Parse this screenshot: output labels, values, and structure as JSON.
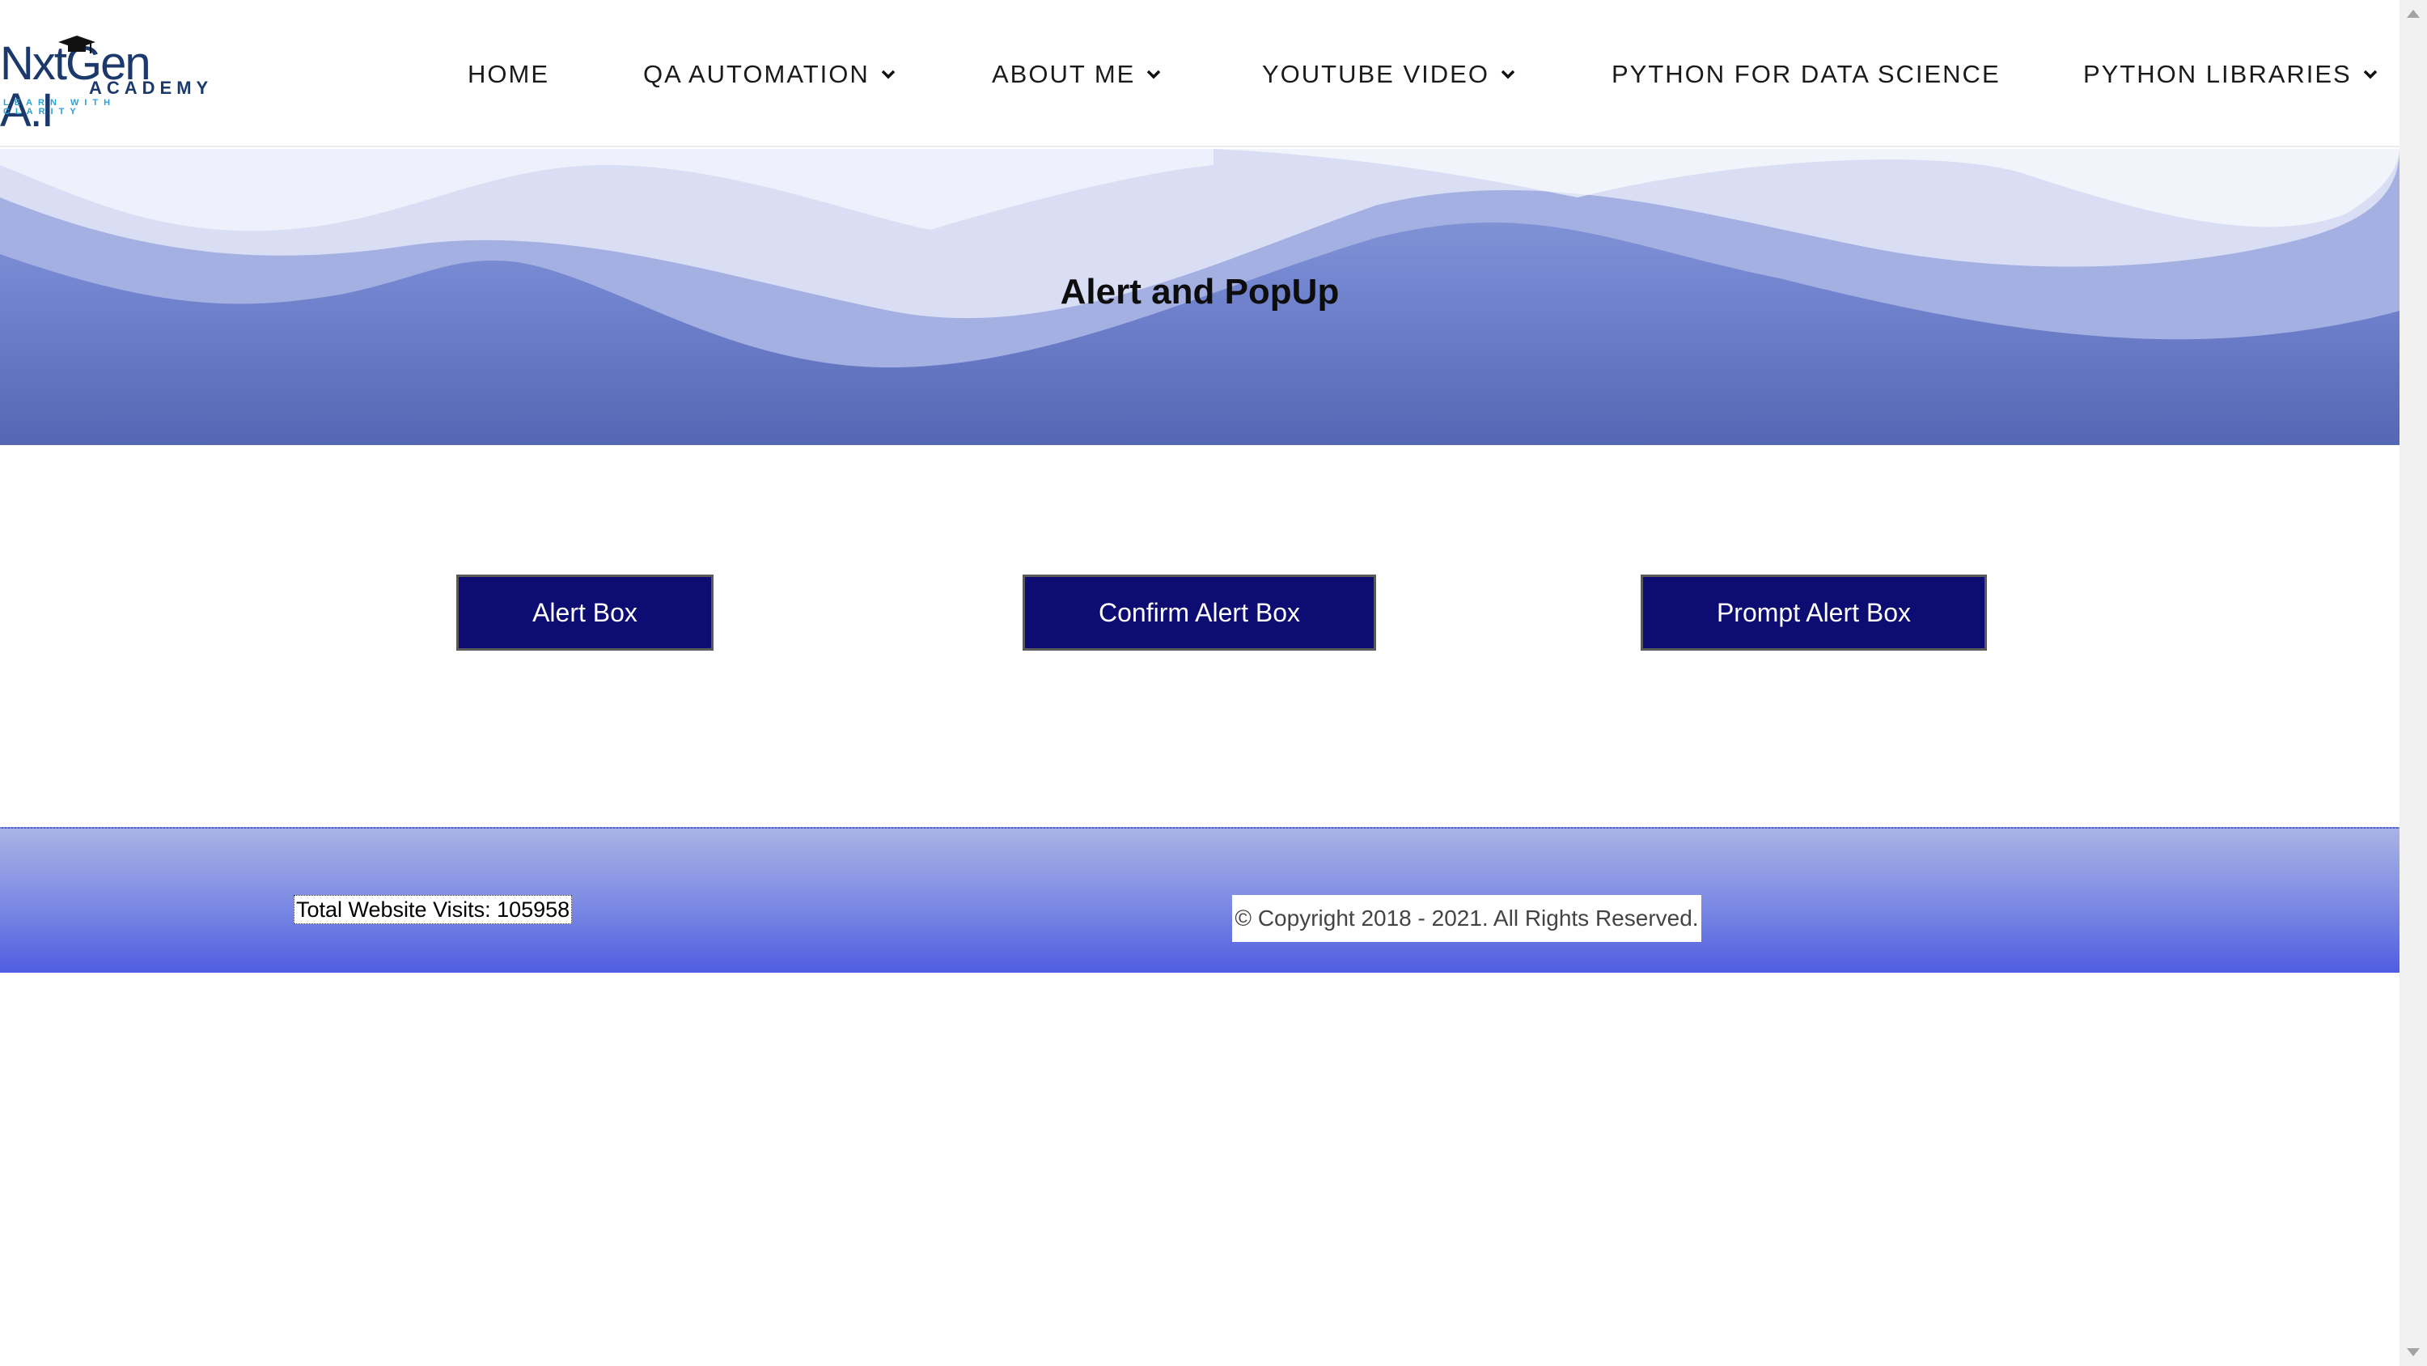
{
  "brand": {
    "logo_main": "NxtGen A.I",
    "logo_sub": "ACADEMY",
    "logo_tagline": "LEARN WITH CLARITY"
  },
  "nav": {
    "items": [
      {
        "label": "HOME",
        "has_dropdown": false
      },
      {
        "label": "QA AUTOMATION",
        "has_dropdown": true
      },
      {
        "label": "ABOUT ME",
        "has_dropdown": true
      },
      {
        "label": "YOUTUBE VIDEO",
        "has_dropdown": true
      },
      {
        "label": "PYTHON FOR DATA SCIENCE",
        "has_dropdown": false
      },
      {
        "label": "PYTHON LIBRARIES",
        "has_dropdown": true
      }
    ]
  },
  "hero": {
    "title": "Alert and PopUp"
  },
  "buttons": {
    "alert": "Alert Box",
    "confirm": "Confirm Alert Box",
    "prompt": "Prompt Alert Box"
  },
  "footer": {
    "visits": "Total Website Visits: 105958",
    "copyright": "© Copyright 2018 - 2021. All Rights Reserved."
  },
  "colors": {
    "button_bg": "#0c0c72",
    "hero_gradient": [
      "#8fa0dc",
      "#5566b4"
    ],
    "footer_gradient": [
      "#a9b3e6",
      "#4f5de2"
    ],
    "brand_dark": "#1b3a6b",
    "brand_light": "#29a3d8"
  },
  "icons": {
    "dropdown": "chevron-down-icon",
    "logo_cap": "graduation-cap-icon"
  }
}
